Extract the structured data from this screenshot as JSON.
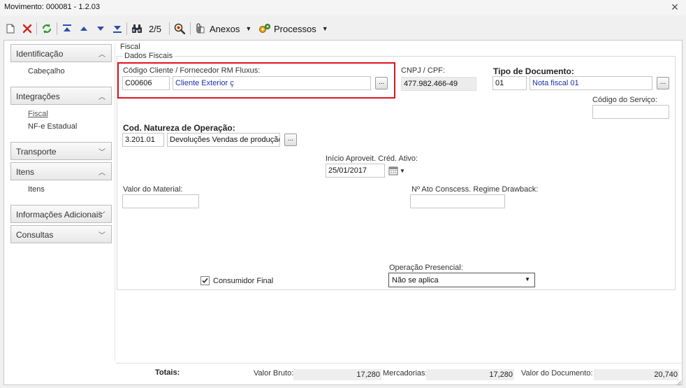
{
  "window": {
    "title": "Movimento: 000081 - 1.2.03"
  },
  "toolbar": {
    "counter": "2/5",
    "anexos_label": "Anexos",
    "processos_label": "Processos"
  },
  "sidebar": {
    "identificacao": "Identificação",
    "cabecalho": "Cabeçalho",
    "integracoes": "Integrações",
    "fiscal": "Fiscal",
    "nfe_estadual": "NF-e Estadual",
    "transporte": "Transporte",
    "itens": "Itens",
    "itens_sub": "Itens",
    "info_adicionais": "Informações Adicionais",
    "consultas": "Consultas"
  },
  "form": {
    "section_title": "Fiscal",
    "group_title": "Dados Fiscais",
    "cliente_label": "Código Cliente / Fornecedor RM Fluxus:",
    "cliente_code": "C00606",
    "cliente_name": "Cliente Exterior ç",
    "cnpj_label": "CNPJ / CPF:",
    "cnpj_value": "477.982.466-49",
    "tipo_doc_label": "Tipo de Documento:",
    "tipo_doc_code": "01",
    "tipo_doc_name": "Nota fiscal 01",
    "codigo_servico_label": "Código do Serviço:",
    "natureza_label": "Cod. Natureza de Operação:",
    "natureza_code": "3.201.01",
    "natureza_name": "Devoluções Vendas de produção",
    "inicio_label": "Início Aproveit. Créd. Ativo:",
    "inicio_value": "25/01/2017",
    "valor_material_label": "Valor do Material:",
    "ato_label": "Nº Ato Conscess. Regime Drawback:",
    "consumidor_final_label": "Consumidor Final",
    "consumidor_final_checked": true,
    "operacao_label": "Operação Presencial:",
    "operacao_value": "Não se aplica",
    "ellipsis": "..."
  },
  "totals": {
    "label": "Totais:",
    "valor_bruto_label": "Valor Bruto:",
    "valor_bruto_value": "17,280",
    "mercadorias_label": "Mercadorias:",
    "mercadorias_value": "17,280",
    "valor_documento_label": "Valor do Documento:",
    "valor_documento_value": "20,740"
  },
  "colors": {
    "highlight": "#e0141e",
    "link_blue": "#1a2fa8"
  }
}
